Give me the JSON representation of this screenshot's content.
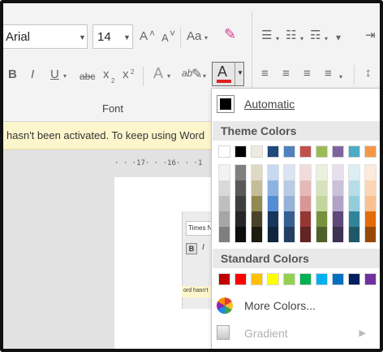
{
  "ribbon": {
    "font_name": "Arial",
    "font_size": "14",
    "group_label": "Font",
    "buttons": {
      "grow": "A",
      "shrink": "A",
      "change_case": "Aa",
      "bold": "B",
      "italic": "I",
      "underline": "U",
      "strikethrough": "abc",
      "subscript": "x",
      "superscript": "x",
      "text_effects": "A",
      "highlight": "ab",
      "font_color": "A"
    },
    "font_color_value": "#e02020"
  },
  "message_bar": {
    "text": "hasn't been activated. To keep using Word"
  },
  "ruler": {
    "text": "· · ·17· · ·16· · ·1"
  },
  "mini_window": {
    "font_name": "Times New Roman",
    "bold": "B",
    "italic": "I",
    "message": "ord hasn't"
  },
  "color_menu": {
    "automatic_label": "Automatic",
    "automatic_color": "#000000",
    "theme_header": "Theme Colors",
    "standard_header": "Standard Colors",
    "more_colors_label": "More Colors...",
    "gradient_label": "Gradient",
    "theme_colors": [
      {
        "base": "#ffffff",
        "shades": [
          "#f2f2f2",
          "#d9d9d9",
          "#bfbfbf",
          "#a6a6a6",
          "#7f7f7f"
        ]
      },
      {
        "base": "#000000",
        "shades": [
          "#7f7f7f",
          "#595959",
          "#3f3f3f",
          "#262626",
          "#0d0d0d"
        ]
      },
      {
        "base": "#eeece1",
        "shades": [
          "#ddd9c3",
          "#c4bd97",
          "#938953",
          "#494429",
          "#1d1b10"
        ]
      },
      {
        "base": "#1f497d",
        "shades": [
          "#c6d9f0",
          "#8db3e2",
          "#548dd4",
          "#17365d",
          "#0f243e"
        ]
      },
      {
        "base": "#4f81bd",
        "shades": [
          "#dbe5f1",
          "#b8cce4",
          "#95b3d7",
          "#366092",
          "#244061"
        ]
      },
      {
        "base": "#c0504d",
        "shades": [
          "#f2dcdb",
          "#e5b9b7",
          "#d99694",
          "#953734",
          "#632423"
        ]
      },
      {
        "base": "#9bbb59",
        "shades": [
          "#ebf1dd",
          "#d7e3bc",
          "#c3d69b",
          "#76923c",
          "#4f6128"
        ]
      },
      {
        "base": "#8064a2",
        "shades": [
          "#e5e0ec",
          "#ccc1d9",
          "#b2a2c7",
          "#5f497a",
          "#3f3151"
        ]
      },
      {
        "base": "#4bacc6",
        "shades": [
          "#dbeef3",
          "#b7dde8",
          "#92cddc",
          "#31859b",
          "#205867"
        ]
      },
      {
        "base": "#f79646",
        "shades": [
          "#fdeada",
          "#fbd5b5",
          "#fac08f",
          "#e36c09",
          "#974806"
        ]
      }
    ],
    "standard_colors": [
      "#c00000",
      "#ff0000",
      "#ffc000",
      "#ffff00",
      "#92d050",
      "#00b050",
      "#00b0f0",
      "#0070c0",
      "#002060",
      "#7030a0"
    ]
  }
}
